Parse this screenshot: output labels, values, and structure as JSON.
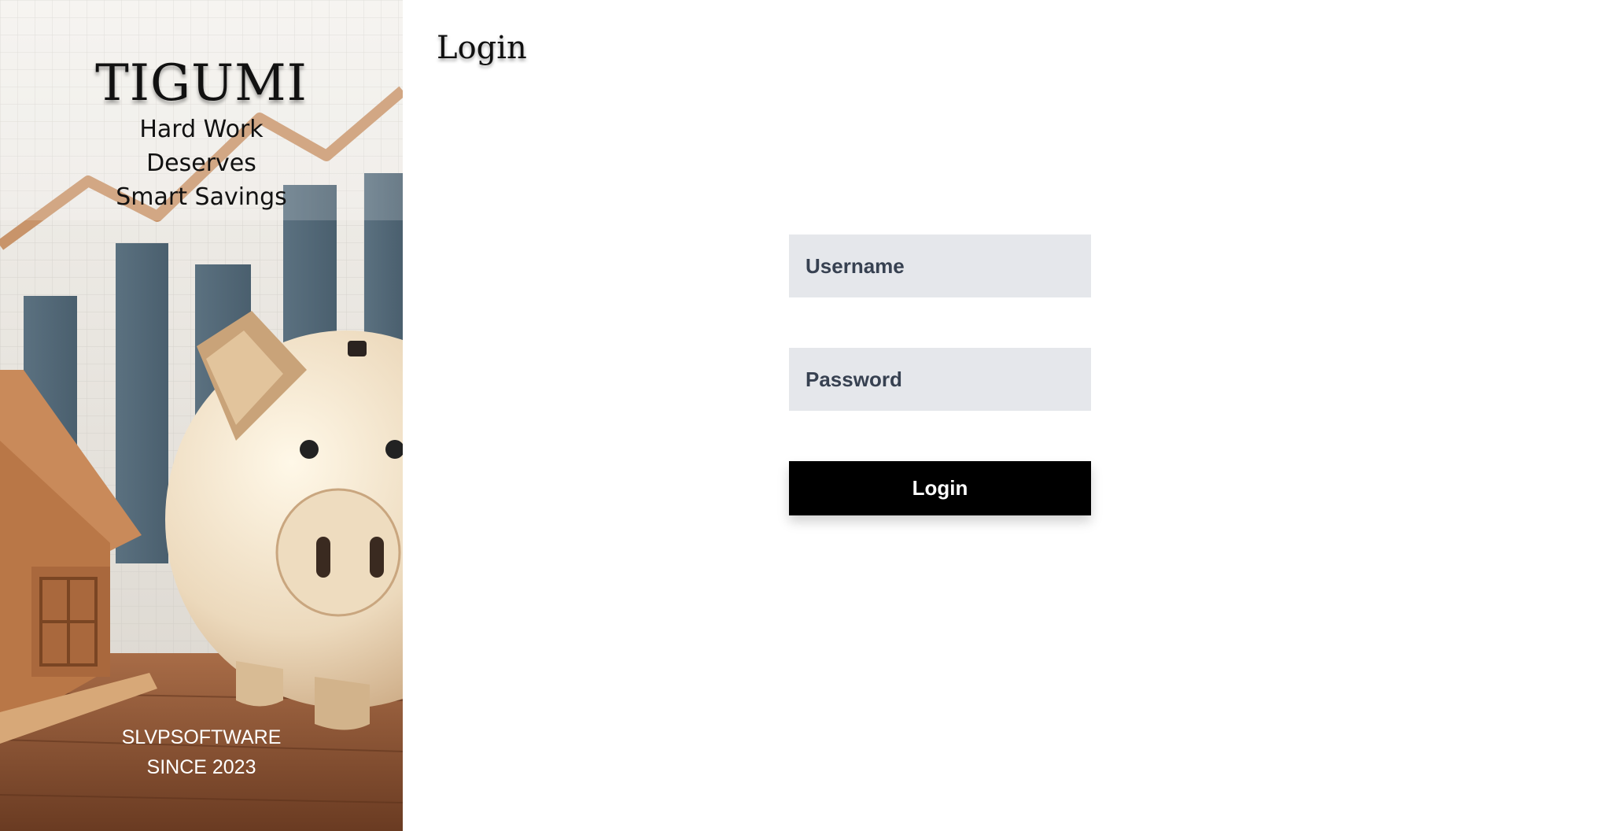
{
  "hero": {
    "brand_name": "TIGUMI",
    "tagline_lines": [
      "Hard Work",
      "Deserves",
      "Smart Savings"
    ],
    "footer_lines": [
      "SLVPSOFTWARE",
      "SINCE 2023"
    ],
    "image_subject": "piggy-bank-with-bar-chart-and-wooden-house"
  },
  "page": {
    "title": "Login"
  },
  "form": {
    "username": {
      "value": "",
      "placeholder": "Username"
    },
    "password": {
      "value": "",
      "placeholder": "Password"
    },
    "submit_label": "Login"
  },
  "colors": {
    "field_bg": "#e5e7eb",
    "field_text": "#374151",
    "button_bg": "#000000",
    "button_text": "#ffffff",
    "page_bg": "#ffffff"
  }
}
